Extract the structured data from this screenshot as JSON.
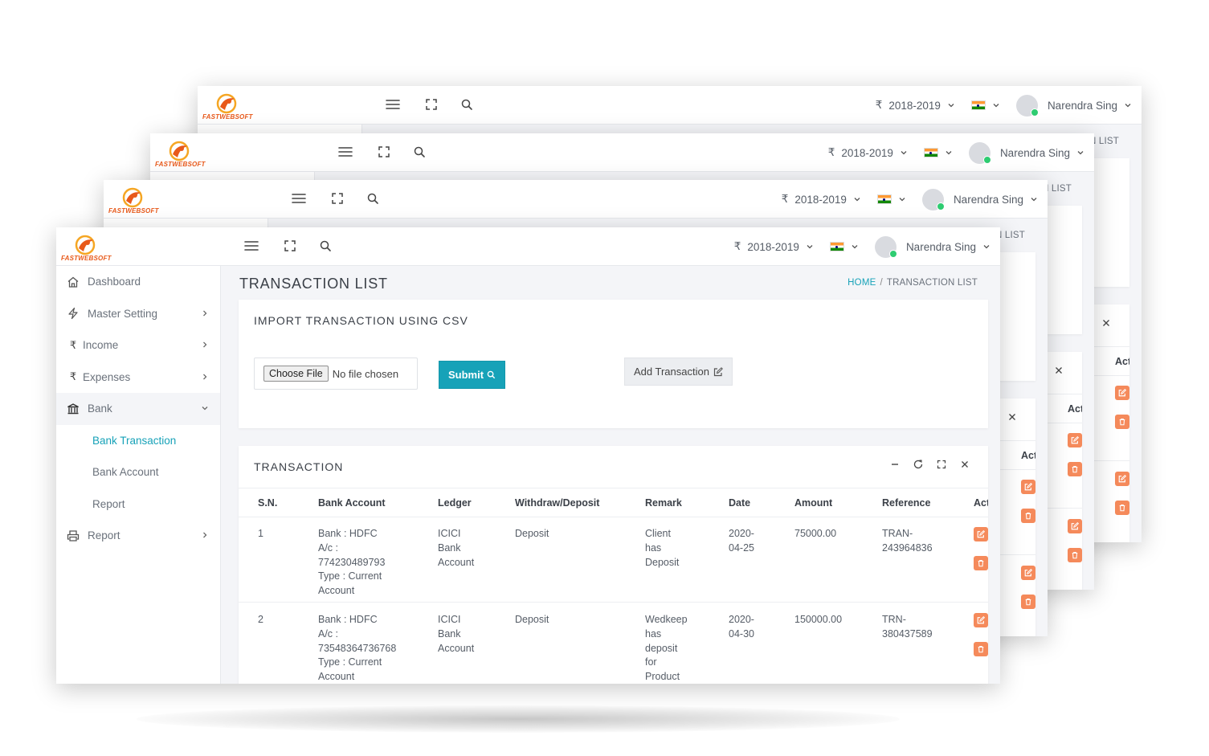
{
  "brand": {
    "name": "FASTWEBSOFT"
  },
  "topbar": {
    "currency_symbol": "₹",
    "fiscal_year": "2018-2019",
    "user_name": "Narendra Sing"
  },
  "sidebar": {
    "items": [
      {
        "label": "Dashboard",
        "icon": "home-icon"
      },
      {
        "label": "Master Setting",
        "icon": "bolt-icon"
      },
      {
        "label": "Income",
        "icon": "rupee-icon"
      },
      {
        "label": "Expenses",
        "icon": "rupee-icon"
      },
      {
        "label": "Bank",
        "icon": "bank-icon"
      },
      {
        "label": "Report",
        "icon": "printer-icon"
      }
    ],
    "sub_items": [
      {
        "label": "Bank Transaction"
      },
      {
        "label": "Bank Account"
      },
      {
        "label": "Report"
      }
    ]
  },
  "page": {
    "title": "TRANSACTION LIST",
    "breadcrumb_home": "HOME",
    "breadcrumb_sep": "/",
    "breadcrumb_current": "TRANSACTION LIST"
  },
  "import_card": {
    "title": "IMPORT TRANSACTION USING CSV",
    "file_button": "Choose File",
    "file_status": "No file chosen",
    "submit_label": "Submit",
    "add_label": "Add Transaction"
  },
  "transaction_card": {
    "title": "TRANSACTION",
    "columns": [
      "S.N.",
      "Bank Account",
      "Ledger",
      "Withdraw/Deposit",
      "Remark",
      "Date",
      "Amount",
      "Reference",
      "Act"
    ],
    "rows": [
      {
        "sn": "1",
        "bank_lines": [
          "Bank : HDFC",
          "A/c :",
          "774230489793",
          "Type : Current",
          "Account"
        ],
        "ledger_lines": [
          "ICICI",
          "Bank",
          "Account"
        ],
        "type": "Deposit",
        "remark_lines": [
          "Client",
          "has",
          "Deposit"
        ],
        "date_lines": [
          "2020-",
          "04-25"
        ],
        "amount": "75000.00",
        "reference_lines": [
          "TRAN-",
          "243964836"
        ]
      },
      {
        "sn": "2",
        "bank_lines": [
          "Bank : HDFC",
          "A/c :",
          "73548364736768",
          "Type : Current",
          "Account"
        ],
        "ledger_lines": [
          "ICICI",
          "Bank",
          "Account"
        ],
        "type": "Deposit",
        "remark_lines": [
          "Wedkeep",
          "has",
          "deposit",
          "for",
          "Product"
        ],
        "date_lines": [
          "2020-",
          "04-30"
        ],
        "amount": "150000.00",
        "reference_lines": [
          "TRN-",
          "380437589"
        ]
      }
    ]
  },
  "colors": {
    "accent": "#17a2b8",
    "action": "#f58a5b",
    "logo": "#e8591a"
  }
}
